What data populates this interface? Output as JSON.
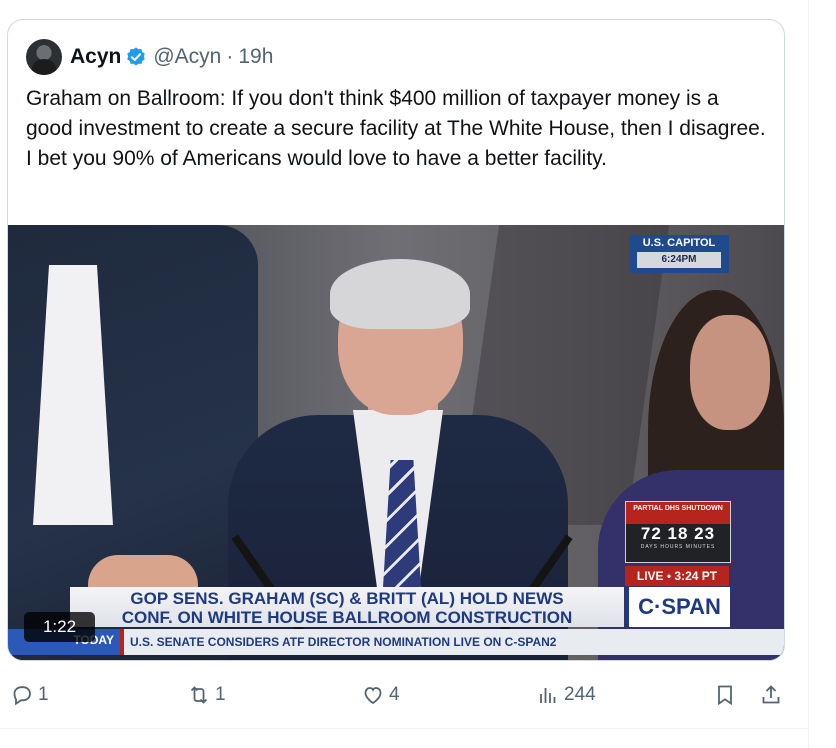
{
  "quote": {
    "author_name": "Acyn",
    "handle": "@Acyn",
    "separator": "·",
    "time": "19h",
    "text": "Graham on Ballroom: If you don't think $400 million of taxpayer money is a good investment to create a secure facility at The White House, then I disagree. I bet you 90% of Americans would love to have a better facility."
  },
  "video": {
    "duration": "1:22",
    "bug_location": "U.S. CAPITOL",
    "bug_time": "6:24PM",
    "dhs_title": "PARTIAL DHS SHUTDOWN",
    "dhs_counts": "72 18 23",
    "dhs_units": "DAYS HOURS MINUTES",
    "live_label": "LIVE • 3:24 PT",
    "chyron_line1": "GOP SENS. GRAHAM (SC) & BRITT (AL) HOLD NEWS",
    "chyron_line2": "CONF. ON WHITE HOUSE BALLROOM CONSTRUCTION",
    "network": "C·SPAN",
    "ticker_label": "TODAY",
    "ticker_text": "U.S. SENATE CONSIDERS ATF DIRECTOR NOMINATION  LIVE ON C-SPAN2"
  },
  "actions": {
    "replies": "1",
    "reposts": "1",
    "likes": "4",
    "views": "244"
  },
  "icons": [
    "verified-badge-icon",
    "reply-icon",
    "repost-icon",
    "like-icon",
    "views-icon",
    "bookmark-icon",
    "share-icon"
  ],
  "colors": {
    "verified": "#1d9bf0",
    "muted_text": "#536471",
    "border": "#cfd9de"
  }
}
